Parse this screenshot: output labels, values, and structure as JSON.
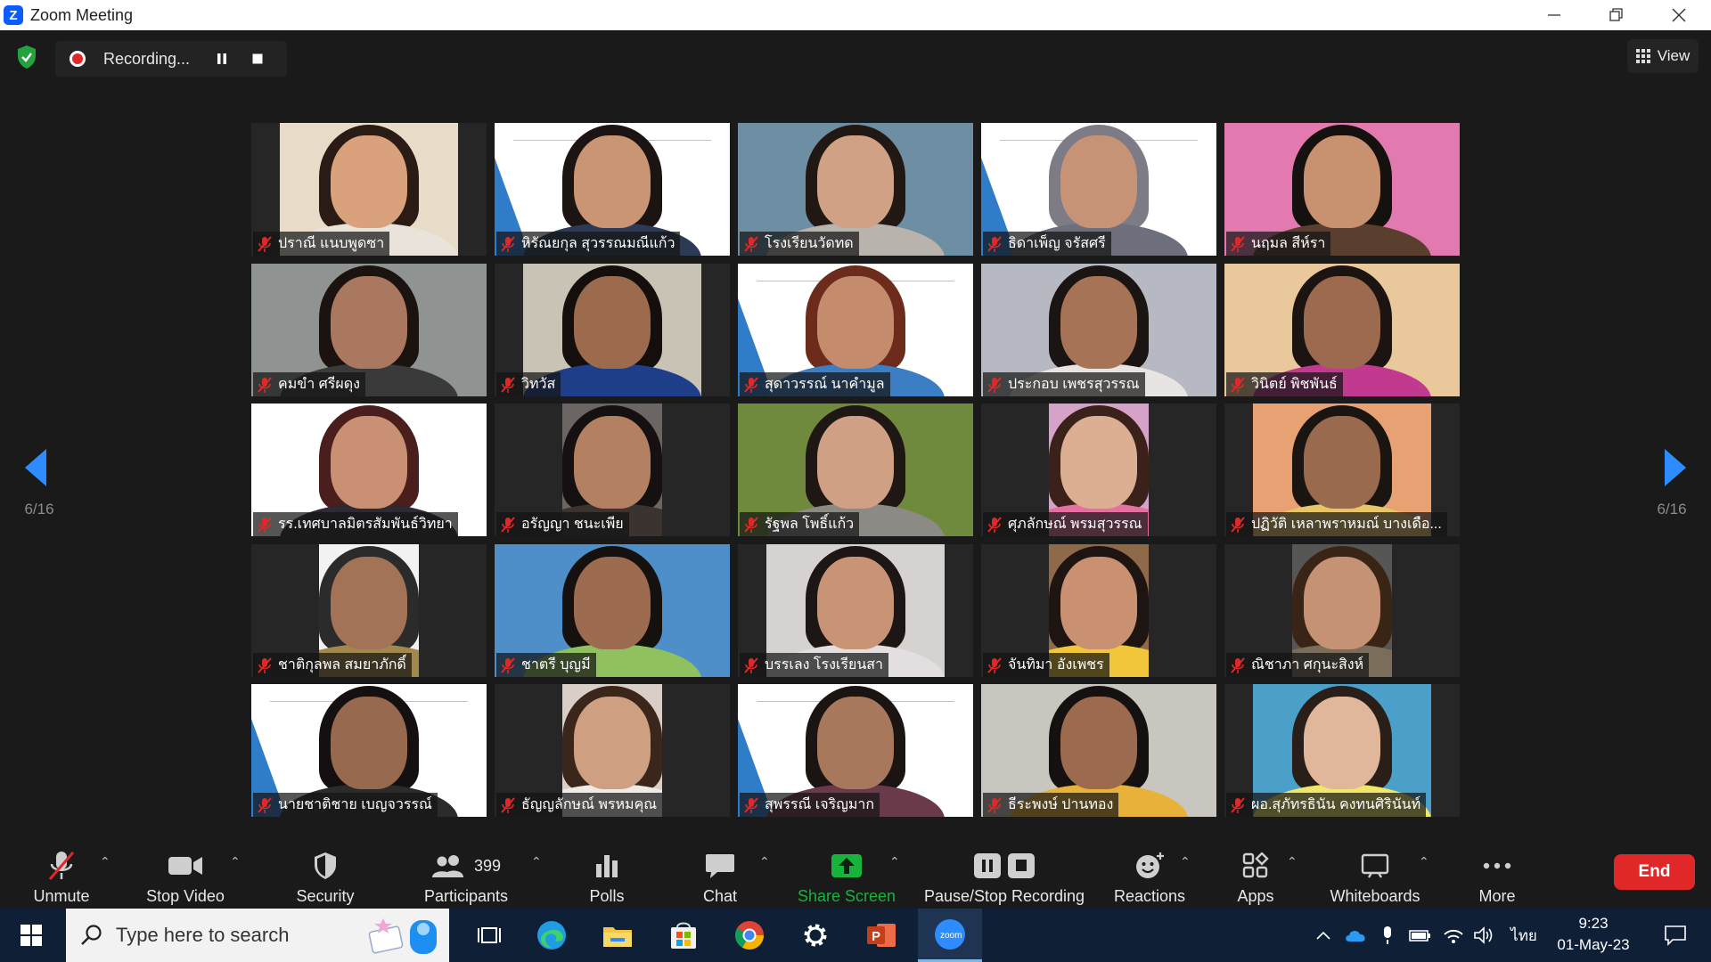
{
  "window": {
    "title": "Zoom Meeting"
  },
  "top_bar": {
    "recording_label": "Recording...",
    "view_label": "View"
  },
  "page_indicator": {
    "left": "6/16",
    "right": "6/16"
  },
  "participants": [
    {
      "name": "ปราณี แนบพูดซา",
      "bg": "#e8dcc8",
      "skin": "#d9a27c",
      "hair": "#2a1c14",
      "shirt": "#e9e3d9",
      "type": "person"
    },
    {
      "name": "หิรัณยกุล สุวรรณมณีแก้ว",
      "bg": "#ffffff",
      "skin": "#c99574",
      "hair": "#1c1412",
      "shirt": "#2c3a55",
      "type": "slide"
    },
    {
      "name": "โรงเรียนวัดทด",
      "bg": "#6e8ea3",
      "skin": "#d0a185",
      "hair": "#221813",
      "shirt": "#b9b3ad",
      "type": "person"
    },
    {
      "name": "ธิดาเพ็ญ จรัสศรี",
      "bg": "#ffffff",
      "skin": "#c69377",
      "hair": "#7d7b86",
      "shirt": "#6e6f7c",
      "type": "slide"
    },
    {
      "name": "นฤมล สีห์รา",
      "bg": "#e27ab0",
      "skin": "#c8916f",
      "hair": "#15110f",
      "shirt": "#5a3f2f",
      "type": "person"
    },
    {
      "name": "คมขำ ศรีผดุง",
      "bg": "#8f9493",
      "skin": "#a9785e",
      "hair": "#1a1310",
      "shirt": "#3b3a3a",
      "type": "person"
    },
    {
      "name": "วิทวัส",
      "bg": "#c9c3b5",
      "skin": "#9c6b4d",
      "hair": "#140f0d",
      "shirt": "#1e3e8a",
      "type": "person"
    },
    {
      "name": "สุดาวรรณ์ นาคำมูล",
      "bg": "#ffffff",
      "skin": "#c48b6c",
      "hair": "#6d2b1c",
      "shirt": "#3b7ec4",
      "type": "slide"
    },
    {
      "name": "ประกอบ เพชรสุวรรณ",
      "bg": "#b6b9c2",
      "skin": "#a77356",
      "hair": "#1a1412",
      "shirt": "#e8e4e2",
      "type": "person"
    },
    {
      "name": "วินิตย์ พิชพันธ์",
      "bg": "#e9c89c",
      "skin": "#9c6a4f",
      "hair": "#1c1410",
      "shirt": "#c23a8f",
      "type": "person"
    },
    {
      "name": "รร.เทศบาลมิตรสัมพันธ์วิทยา",
      "bg": "#ffffff",
      "skin": "#c99073",
      "hair": "#4a1e1c",
      "shirt": "#2d2a33",
      "type": "person"
    },
    {
      "name": "อรัญญา ชนะเพีย",
      "bg": "#6b6663",
      "skin": "#b38062",
      "hair": "#151111",
      "shirt": "#3a3330",
      "type": "person"
    },
    {
      "name": "รัฐพล โพธิ์แก้ว",
      "bg": "#6f8a3d",
      "skin": "#d0a085",
      "hair": "#1f1714",
      "shirt": "#8b8a85",
      "type": "person"
    },
    {
      "name": "ศุภลักษณ์ พรมสุวรรณ",
      "bg": "#d4a3c7",
      "skin": "#dcae92",
      "hair": "#3a221a",
      "shirt": "#e66fa2",
      "type": "person"
    },
    {
      "name": "ปฏิวัติ เหลาพราหมณ์ บางเดือ...",
      "bg": "#e7a172",
      "skin": "#9a6a4e",
      "hair": "#1b1512",
      "shirt": "#e7c66a",
      "type": "person"
    },
    {
      "name": "ชาติกุลพล สมยาภักดิ์",
      "bg": "#f2f2f2",
      "skin": "#a37357",
      "hair": "#2b2b2b",
      "shirt": "#a1884d",
      "type": "person"
    },
    {
      "name": "ชาตรี บุญมี",
      "bg": "#4f8fc9",
      "skin": "#9d6b4f",
      "hair": "#15110f",
      "shirt": "#8fc15e",
      "type": "person"
    },
    {
      "name": "บรรเลง โรงเรียนสา",
      "bg": "#d6d2cf",
      "skin": "#c99475",
      "hair": "#1c1614",
      "shirt": "#e3dfe0",
      "type": "person"
    },
    {
      "name": "จันทิมา อังเพชร",
      "bg": "#8f6a4a",
      "skin": "#c99072",
      "hair": "#1e1512",
      "shirt": "#f1c63a",
      "type": "person"
    },
    {
      "name": "ณิชาภา ศกุนะสิงห์",
      "bg": "#565654",
      "skin": "#c69274",
      "hair": "#3a2416",
      "shirt": "#7a6e5a",
      "type": "person"
    },
    {
      "name": "นายชาติชาย เบญจวรรณ์",
      "bg": "#ffffff",
      "skin": "#97694f",
      "hair": "#141010",
      "shirt": "#2b2b2b",
      "type": "slide"
    },
    {
      "name": "ธัญญลักษณ์ พรหมคุณ",
      "bg": "#d8cfc6",
      "skin": "#cf9f82",
      "hair": "#3a261b",
      "shirt": "#efeae6",
      "type": "person"
    },
    {
      "name": "สุพรรณี เจริญมาก",
      "bg": "#ffffff",
      "skin": "#a8785c",
      "hair": "#1a1412",
      "shirt": "#6b3a4a",
      "type": "slide"
    },
    {
      "name": "ธีระพงษ์ ปานทอง",
      "bg": "#c9c6bf",
      "skin": "#9b6a4f",
      "hair": "#151110",
      "shirt": "#e8b23a",
      "type": "person"
    },
    {
      "name": "ผอ.สุภัทรธินัน คงทนศิรินันท์",
      "bg": "#4aa0c8",
      "skin": "#e0b79a",
      "hair": "#2a1e18",
      "shirt": "#f0e66a",
      "type": "person"
    }
  ],
  "toolbar": {
    "unmute": "Unmute",
    "stop_video": "Stop Video",
    "security": "Security",
    "participants": "Participants",
    "participant_count": "399",
    "polls": "Polls",
    "chat": "Chat",
    "share_screen": "Share Screen",
    "pause_stop_recording": "Pause/Stop Recording",
    "reactions": "Reactions",
    "apps": "Apps",
    "whiteboards": "Whiteboards",
    "more": "More",
    "end": "End"
  },
  "taskbar": {
    "search_placeholder": "Type here to search",
    "language": "ไทย",
    "time": "9:23",
    "date": "01-May-23"
  },
  "colors": {
    "accent": "#2d8cff",
    "end": "#e02828",
    "share": "#17b33a",
    "mute": "#e02828"
  }
}
